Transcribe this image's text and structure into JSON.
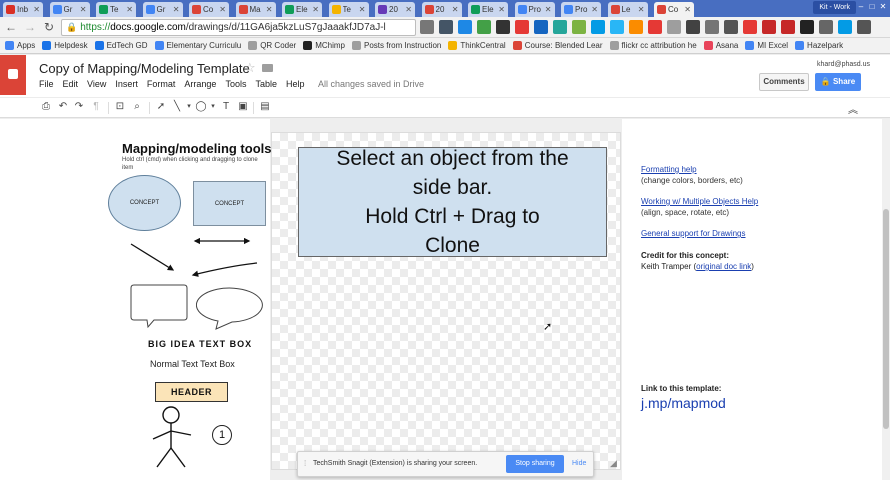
{
  "browser": {
    "tabs": [
      {
        "label": "Inb",
        "color": "#d93025"
      },
      {
        "label": "Gr",
        "color": "#4285f4"
      },
      {
        "label": "Te",
        "color": "#0f9d58"
      },
      {
        "label": "Gr",
        "color": "#4285f4"
      },
      {
        "label": "Co",
        "color": "#db4437"
      },
      {
        "label": "Ma",
        "color": "#db4437"
      },
      {
        "label": "Ele",
        "color": "#0f9d58"
      },
      {
        "label": "Te",
        "color": "#f4b400"
      },
      {
        "label": "20",
        "color": "#673ab7"
      },
      {
        "label": "20",
        "color": "#db4437"
      },
      {
        "label": "Ele",
        "color": "#0f9d58"
      },
      {
        "label": "Pro",
        "color": "#4285f4"
      },
      {
        "label": "Pro",
        "color": "#4285f4"
      },
      {
        "label": "Le",
        "color": "#db4437"
      },
      {
        "label": "Co",
        "color": "#db4437"
      }
    ],
    "profile": "Kit - Work",
    "url_https": "https://",
    "url_host": "docs.google.com",
    "url_path": "/drawings/d/11GA6ja5kzLuS7gJaaakfJD7aJ-l",
    "bookmarks": [
      {
        "label": "Apps",
        "color": "#4285f4"
      },
      {
        "label": "Helpdesk",
        "color": "#1a73e8"
      },
      {
        "label": "EdTech GD",
        "color": "#1a73e8"
      },
      {
        "label": "Elementary Curriculu",
        "color": "#4285f4"
      },
      {
        "label": "QR Coder",
        "color": "#9e9e9e"
      },
      {
        "label": "MChimp",
        "color": "#222222"
      },
      {
        "label": "Posts from Instruction",
        "color": "#9e9e9e"
      },
      {
        "label": "ThinkCentral",
        "color": "#f4b400"
      },
      {
        "label": "Course: Blended Lear",
        "color": "#db4437"
      },
      {
        "label": "flickr cc attribution he",
        "color": "#9e9e9e"
      },
      {
        "label": "Asana",
        "color": "#e8445a"
      },
      {
        "label": "MI Excel",
        "color": "#4285f4"
      },
      {
        "label": "Hazelpark",
        "color": "#4285f4"
      }
    ]
  },
  "docs": {
    "title": "Copy of Mapping/Modeling Template",
    "menu": [
      "File",
      "Edit",
      "View",
      "Insert",
      "Format",
      "Arrange",
      "Tools",
      "Table",
      "Help"
    ],
    "save_status": "All changes saved in Drive",
    "user_email": "khard@phasd.us",
    "comments_label": "Comments",
    "share_label": "Share"
  },
  "left_panel": {
    "title": "Mapping/modeling tools.",
    "hint": "Hold ctrl (cmd) when clicking and dragging to clone item",
    "concept_oval": "CONCEPT",
    "concept_rect": "CONCEPT",
    "big_idea": "BIG IDEA TEXT BOX",
    "normal_text": "Normal Text Text Box",
    "header": "HEADER",
    "number": "1"
  },
  "canvas": {
    "line1": "Select an object from the",
    "line2": "side bar.",
    "line3": "Hold Ctrl + Drag to",
    "line4": "Clone"
  },
  "right_panel": {
    "formatting_help": "Formatting help",
    "formatting_desc": "(change colors, borders, etc)",
    "multiple_help": "Working w/ Multiple Objects Help",
    "multiple_desc": "(align, space, rotate, etc)",
    "general_support": "General support for Drawings",
    "credit_title": "Credit for this concept:",
    "credit_name": "Keith Tramper (",
    "credit_link": "original doc link",
    "credit_close": ")",
    "link_title": "Link to this template:",
    "short_link": "j.mp/mapmod"
  },
  "snagit": {
    "message": "TechSmith Snagit (Extension) is sharing your screen.",
    "stop_label": "Stop sharing",
    "hide_label": "Hide"
  }
}
